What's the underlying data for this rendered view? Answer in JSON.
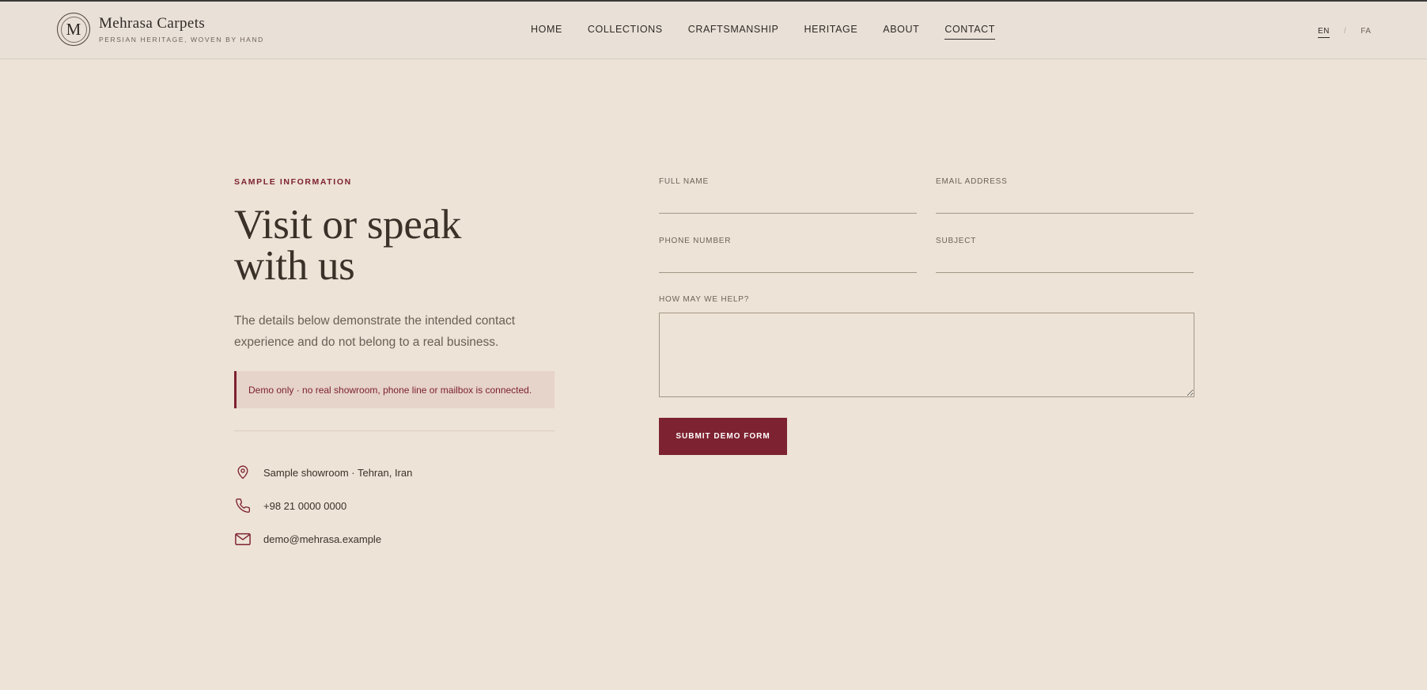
{
  "header": {
    "brand_initial": "M",
    "brand_name": "Mehrasa Carpets",
    "brand_tagline": "PERSIAN HERITAGE, WOVEN BY HAND",
    "nav": [
      "HOME",
      "COLLECTIONS",
      "CRAFTSMANSHIP",
      "HERITAGE",
      "ABOUT",
      "CONTACT"
    ],
    "active_nav": "CONTACT",
    "lang": {
      "en": "EN",
      "separator": "/",
      "fa": "FA"
    }
  },
  "info": {
    "eyebrow": "SAMPLE INFORMATION",
    "title_line1": "Visit or speak",
    "title_line2": "with us",
    "lead": "The details below demonstrate the intended contact experience and do not belong to a real business.",
    "notice": "Demo only · no real showroom, phone line or mailbox is connected.",
    "contacts": [
      {
        "icon": "location-pin-icon",
        "text": "Sample showroom · Tehran, Iran"
      },
      {
        "icon": "phone-icon",
        "text": "+98 21 0000 0000"
      },
      {
        "icon": "mail-icon",
        "text": "demo@mehrasa.example"
      }
    ]
  },
  "form": {
    "full_name_label": "FULL NAME",
    "full_name_value": "",
    "email_label": "EMAIL ADDRESS",
    "email_value": "",
    "phone_label": "PHONE NUMBER",
    "phone_value": "",
    "subject_label": "SUBJECT",
    "subject_value": "",
    "message_label": "HOW MAY WE HELP?",
    "message_value": "",
    "submit_label": "SUBMIT DEMO FORM"
  },
  "colors": {
    "accent": "#7d2230",
    "background": "#ede3d6",
    "header_background": "#e9e0d8",
    "text": "#3a3129"
  }
}
